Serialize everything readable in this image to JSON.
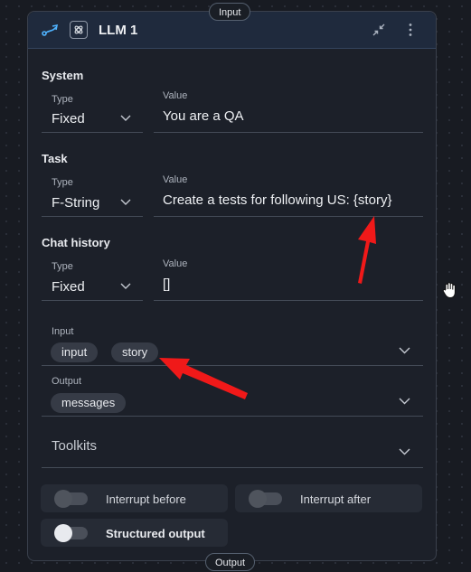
{
  "node": {
    "title": "LLM 1",
    "input_port": "Input",
    "output_port": "Output"
  },
  "system": {
    "title": "System",
    "type_label": "Type",
    "type_value": "Fixed",
    "value_label": "Value",
    "value": "You are a QA"
  },
  "task": {
    "title": "Task",
    "type_label": "Type",
    "type_value": "F-String",
    "value_label": "Value",
    "value": "Create a tests for following US: {story}"
  },
  "chat_history": {
    "title": "Chat history",
    "type_label": "Type",
    "type_value": "Fixed",
    "value_label": "Value",
    "value": "[]"
  },
  "input": {
    "label": "Input",
    "chips": [
      "input",
      "story"
    ]
  },
  "output": {
    "label": "Output",
    "chips": [
      "messages"
    ]
  },
  "toolkits": {
    "label": "Toolkits"
  },
  "toggles": {
    "interrupt_before": "Interrupt before",
    "interrupt_after": "Interrupt after",
    "structured_output": "Structured output"
  },
  "colors": {
    "accent": "#4fb3ff",
    "annotation_arrow": "#f01919",
    "node_header": "#1f2a3d"
  }
}
